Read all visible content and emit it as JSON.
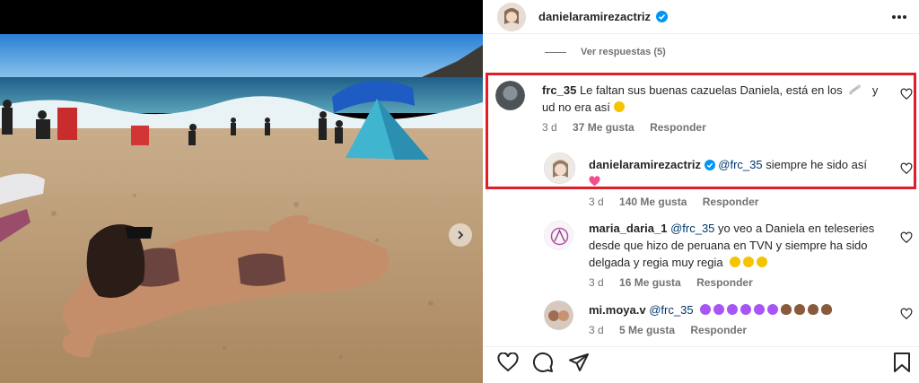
{
  "header": {
    "username": "danielaramirezactriz",
    "more_icon": "more-horizontal-icon"
  },
  "thread": {
    "view_replies": "Ver respuestas (5)"
  },
  "comments": [
    {
      "username": "frc_35",
      "text": "Le faltan sus buenas cazuelas Daniela, está en los",
      "text_end": "y",
      "text_line2": "ud no era así",
      "time": "3 d",
      "likes": "37 Me gusta",
      "reply": "Responder"
    },
    {
      "username": "danielaramirezactriz",
      "mention": "@frc_35",
      "text": "siempre he sido así",
      "time": "3 d",
      "likes": "140 Me gusta",
      "reply": "Responder"
    },
    {
      "username": "maria_daria_1",
      "mention": "@frc_35",
      "text": "yo veo a Daniela en teleseries",
      "text_line2": "desde que hizo de peruana en TVN y siempre ha sido",
      "text_line3": "delgada y regia muy regia",
      "time": "3 d",
      "likes": "16 Me gusta",
      "reply": "Responder"
    },
    {
      "username": "mi.moya.v",
      "mention": "@frc_35",
      "time": "3 d",
      "likes": "5 Me gusta",
      "reply": "Responder"
    }
  ],
  "actions": {
    "like_icon": "heart-icon",
    "comment_icon": "comment-icon",
    "share_icon": "send-icon",
    "save_icon": "bookmark-icon"
  },
  "colors": {
    "highlight_border": "#e11d2a",
    "verified_blue": "#0095f6",
    "mention": "#00376b"
  }
}
